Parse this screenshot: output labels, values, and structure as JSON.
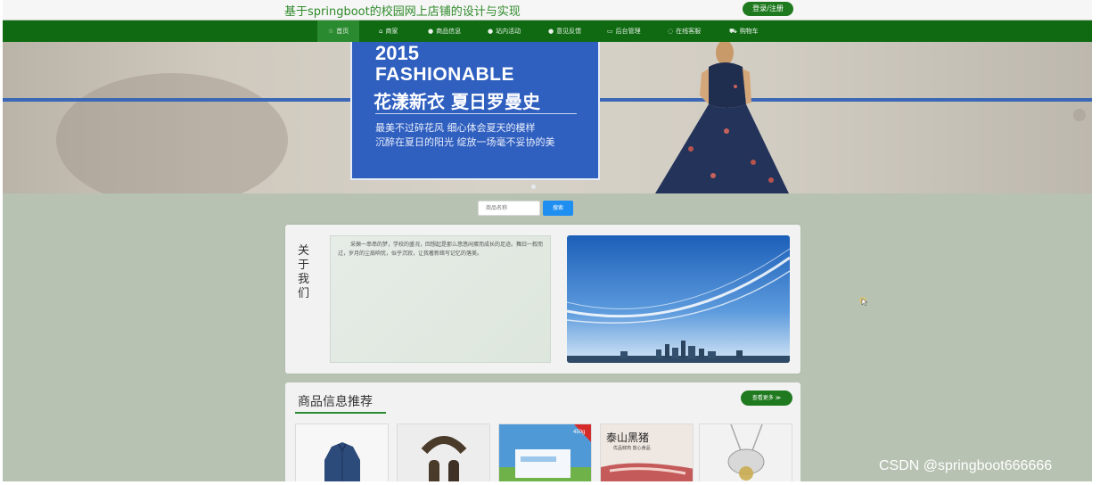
{
  "header": {
    "site_title": "基于springboot的校园网上店铺的设计与实现",
    "login_label": "登录/注册"
  },
  "nav": {
    "items": [
      {
        "icon": "home-icon",
        "glyph": "☆",
        "label": "首页"
      },
      {
        "icon": "house-icon",
        "glyph": "⌂",
        "label": "商家"
      },
      {
        "icon": "info-icon",
        "glyph": "●",
        "label": "商品信息"
      },
      {
        "icon": "activity-icon",
        "glyph": "●",
        "label": "站内活动"
      },
      {
        "icon": "feedback-icon",
        "glyph": "●",
        "label": "意见反馈"
      },
      {
        "icon": "admin-icon",
        "glyph": "▭",
        "label": "后台管理"
      },
      {
        "icon": "service-icon",
        "glyph": "◌",
        "label": "在线客服"
      },
      {
        "icon": "cart-icon",
        "glyph": "⛟",
        "label": "购物车"
      }
    ]
  },
  "banner": {
    "year": "2015",
    "fashion": "FASHIONABLE",
    "headline": "花漾新衣  夏日罗曼史",
    "sub1": "最美不过碎花风 细心体会夏天的模样",
    "sub2": "沉醉在夏日的阳光 绽放一场毫不妥协的美"
  },
  "search": {
    "placeholder": "商品名称",
    "button_label": "搜索"
  },
  "about": {
    "title": "关于我们",
    "text": "采撷一串串的梦，学校的盛况，回想起是那么悠悠闲蛋而成长的足迹。舞曰一叙而过，岁月的尘扇响忧，似乎沉寂，让我著新络写记忆的落美。"
  },
  "goods": {
    "title": "商品信息推荐",
    "more_label": "查看更多 ≫",
    "items": [
      {
        "name": "denim-jacket"
      },
      {
        "name": "fur-scarf"
      },
      {
        "name": "milk-box",
        "badge": "450g"
      },
      {
        "name": "pork-meat",
        "label": "泰山黑猪",
        "sub": "优品鲜肉 放心食品"
      },
      {
        "name": "silver-necklace"
      }
    ]
  },
  "watermark": "CSDN @springboot666666",
  "colors": {
    "nav_bg": "#0f6a12",
    "title_green": "#2f8a2a",
    "accent_blue": "#1f8ef1",
    "banner_card": "#2f5fbf",
    "page_bg": "#b7c2b2"
  }
}
